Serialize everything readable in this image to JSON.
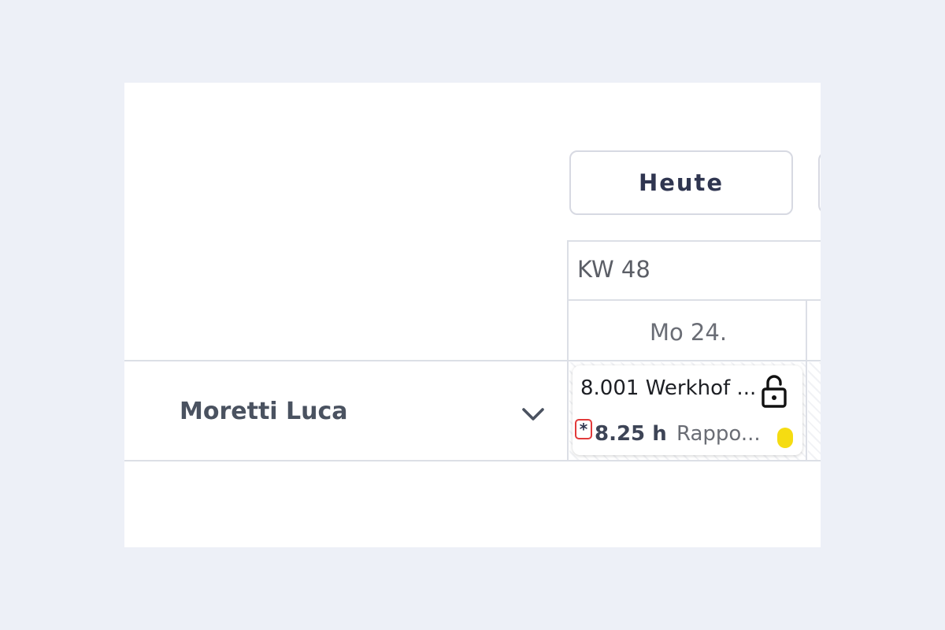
{
  "toolbar": {
    "today_label": "Heute"
  },
  "calendar": {
    "week_label": "KW 48",
    "days": [
      {
        "label": "Mo 24."
      }
    ]
  },
  "rows": [
    {
      "employee": "Moretti Luca",
      "expand_icon": "chevron-down-icon",
      "entries": [
        {
          "title": "8.001 Werkhof ...",
          "lock_icon": "lock-icon",
          "marker": "*",
          "hours": "8.25 h",
          "status": "Rappo...",
          "status_color": "#f5dc12"
        }
      ]
    }
  ],
  "colors": {
    "background": "#edf0f7",
    "panel": "#ffffff",
    "grid": "#dcdfe6",
    "marker_highlight": "#e23a3a",
    "text_dark": "#2f3550"
  }
}
